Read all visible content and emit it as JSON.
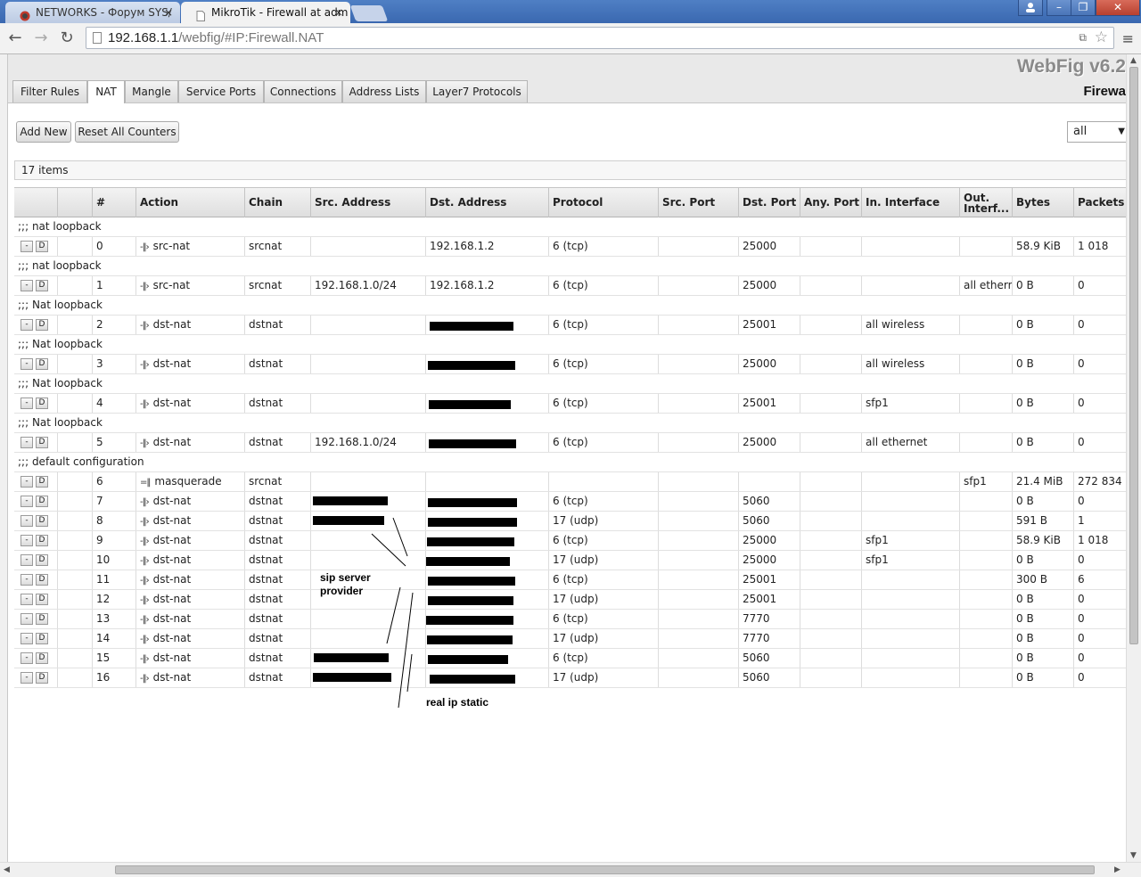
{
  "browser": {
    "tabs": [
      {
        "title": "NETWORKS - Форум SYS/",
        "close": "×"
      },
      {
        "title": "MikroTik - Firewall at adm",
        "close": "×"
      }
    ],
    "window_buttons": [
      "–",
      "❐",
      "✕"
    ],
    "url_host": "192.168.1.1",
    "url_path": "/webfig/#IP:Firewall.NAT",
    "nav": {
      "back": "←",
      "forward": "→",
      "reload": "↻",
      "menu": "≡"
    }
  },
  "header": {
    "brand": "WebFig v6.2",
    "section": "Firewa"
  },
  "tabs": [
    "Filter Rules",
    "NAT",
    "Mangle",
    "Service Ports",
    "Connections",
    "Address Lists",
    "Layer7 Protocols"
  ],
  "active_tab": "NAT",
  "toolbar": {
    "add_label": "Add New",
    "reset_label": "Reset All Counters",
    "filter_value": "all"
  },
  "items_count": "17 items",
  "columns": [
    "",
    "",
    "#",
    "Action",
    "Chain",
    "Src. Address",
    "Dst. Address",
    "Protocol",
    "Src. Port",
    "Dst. Port",
    "Any. Port",
    "In. Interface",
    "Out. Interf...",
    "Bytes",
    "Packets"
  ],
  "row_buttons": {
    "remove": "-",
    "disable": "D"
  },
  "rows": [
    {
      "type": "comment",
      "text": ";;; nat loopback"
    },
    {
      "type": "rule",
      "num": "0",
      "action": "src-nat",
      "icon": "-‖›",
      "chain": "srcnat",
      "src": "",
      "dst": "192.168.1.2",
      "proto": "6 (tcp)",
      "sport": "",
      "dport": "25000",
      "anyport": "",
      "in": "",
      "out": "",
      "bytes": "58.9 KiB",
      "packets": "1 018"
    },
    {
      "type": "comment",
      "text": ";;; nat loopback"
    },
    {
      "type": "rule",
      "num": "1",
      "action": "src-nat",
      "icon": "-‖›",
      "chain": "srcnat",
      "src": "192.168.1.0/24",
      "dst": "192.168.1.2",
      "proto": "6 (tcp)",
      "sport": "",
      "dport": "25000",
      "anyport": "",
      "in": "",
      "out": "all ethern",
      "bytes": "0 B",
      "packets": "0"
    },
    {
      "type": "comment",
      "text": ";;; Nat loopback"
    },
    {
      "type": "rule",
      "num": "2",
      "action": "dst-nat",
      "icon": "-‖›",
      "chain": "dstnat",
      "src": "",
      "dst": "",
      "proto": "6 (tcp)",
      "sport": "",
      "dport": "25001",
      "anyport": "",
      "in": "all wireless",
      "out": "",
      "bytes": "0 B",
      "packets": "0"
    },
    {
      "type": "comment",
      "text": ";;; Nat loopback"
    },
    {
      "type": "rule",
      "num": "3",
      "action": "dst-nat",
      "icon": "-‖›",
      "chain": "dstnat",
      "src": "",
      "dst": "",
      "proto": "6 (tcp)",
      "sport": "",
      "dport": "25000",
      "anyport": "",
      "in": "all wireless",
      "out": "",
      "bytes": "0 B",
      "packets": "0"
    },
    {
      "type": "comment",
      "text": ";;; Nat loopback"
    },
    {
      "type": "rule",
      "num": "4",
      "action": "dst-nat",
      "icon": "-‖›",
      "chain": "dstnat",
      "src": "",
      "dst": "",
      "proto": "6 (tcp)",
      "sport": "",
      "dport": "25001",
      "anyport": "",
      "in": "sfp1",
      "out": "",
      "bytes": "0 B",
      "packets": "0"
    },
    {
      "type": "comment",
      "text": ";;; Nat loopback"
    },
    {
      "type": "rule",
      "num": "5",
      "action": "dst-nat",
      "icon": "-‖›",
      "chain": "dstnat",
      "src": "192.168.1.0/24",
      "dst": "",
      "proto": "6 (tcp)",
      "sport": "",
      "dport": "25000",
      "anyport": "",
      "in": "all ethernet",
      "out": "",
      "bytes": "0 B",
      "packets": "0"
    },
    {
      "type": "comment",
      "text": ";;; default configuration"
    },
    {
      "type": "rule",
      "num": "6",
      "action": "masquerade",
      "icon": "=‖",
      "chain": "srcnat",
      "src": "",
      "dst": "",
      "proto": "",
      "sport": "",
      "dport": "",
      "anyport": "",
      "in": "",
      "out": "sfp1",
      "bytes": "21.4 MiB",
      "packets": "272 834"
    },
    {
      "type": "rule",
      "num": "7",
      "action": "dst-nat",
      "icon": "-‖›",
      "chain": "dstnat",
      "src": "",
      "dst": "",
      "proto": "6 (tcp)",
      "sport": "",
      "dport": "5060",
      "anyport": "",
      "in": "",
      "out": "",
      "bytes": "0 B",
      "packets": "0"
    },
    {
      "type": "rule",
      "num": "8",
      "action": "dst-nat",
      "icon": "-‖›",
      "chain": "dstnat",
      "src": "",
      "dst": "",
      "proto": "17 (udp)",
      "sport": "",
      "dport": "5060",
      "anyport": "",
      "in": "",
      "out": "",
      "bytes": "591 B",
      "packets": "1"
    },
    {
      "type": "rule",
      "num": "9",
      "action": "dst-nat",
      "icon": "-‖›",
      "chain": "dstnat",
      "src": "",
      "dst": "",
      "proto": "6 (tcp)",
      "sport": "",
      "dport": "25000",
      "anyport": "",
      "in": "sfp1",
      "out": "",
      "bytes": "58.9 KiB",
      "packets": "1 018"
    },
    {
      "type": "rule",
      "num": "10",
      "action": "dst-nat",
      "icon": "-‖›",
      "chain": "dstnat",
      "src": "",
      "dst": "",
      "proto": "17 (udp)",
      "sport": "",
      "dport": "25000",
      "anyport": "",
      "in": "sfp1",
      "out": "",
      "bytes": "0 B",
      "packets": "0"
    },
    {
      "type": "rule",
      "num": "11",
      "action": "dst-nat",
      "icon": "-‖›",
      "chain": "dstnat",
      "src": "",
      "dst": "",
      "proto": "6 (tcp)",
      "sport": "",
      "dport": "25001",
      "anyport": "",
      "in": "",
      "out": "",
      "bytes": "300 B",
      "packets": "6"
    },
    {
      "type": "rule",
      "num": "12",
      "action": "dst-nat",
      "icon": "-‖›",
      "chain": "dstnat",
      "src": "",
      "dst": "",
      "proto": "17 (udp)",
      "sport": "",
      "dport": "25001",
      "anyport": "",
      "in": "",
      "out": "",
      "bytes": "0 B",
      "packets": "0"
    },
    {
      "type": "rule",
      "num": "13",
      "action": "dst-nat",
      "icon": "-‖›",
      "chain": "dstnat",
      "src": "",
      "dst": "",
      "proto": "6 (tcp)",
      "sport": "",
      "dport": "7770",
      "anyport": "",
      "in": "",
      "out": "",
      "bytes": "0 B",
      "packets": "0"
    },
    {
      "type": "rule",
      "num": "14",
      "action": "dst-nat",
      "icon": "-‖›",
      "chain": "dstnat",
      "src": "",
      "dst": "",
      "proto": "17 (udp)",
      "sport": "",
      "dport": "7770",
      "anyport": "",
      "in": "",
      "out": "",
      "bytes": "0 B",
      "packets": "0"
    },
    {
      "type": "rule",
      "num": "15",
      "action": "dst-nat",
      "icon": "-‖›",
      "chain": "dstnat",
      "src": "",
      "dst": "",
      "proto": "6 (tcp)",
      "sport": "",
      "dport": "5060",
      "anyport": "",
      "in": "",
      "out": "",
      "bytes": "0 B",
      "packets": "0"
    },
    {
      "type": "rule",
      "num": "16",
      "action": "dst-nat",
      "icon": "-‖›",
      "chain": "dstnat",
      "src": "",
      "dst": "",
      "proto": "17 (udp)",
      "sport": "",
      "dport": "5060",
      "anyport": "",
      "in": "",
      "out": "",
      "bytes": "0 B",
      "packets": "0"
    }
  ],
  "annotations": {
    "sip": "sip server\nprovider",
    "real_ip": "real ip static"
  }
}
